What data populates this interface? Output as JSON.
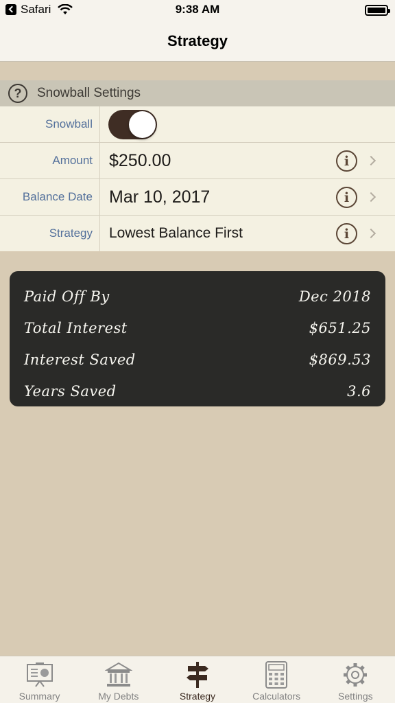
{
  "status_bar": {
    "back_app": "Safari",
    "time": "9:38 AM"
  },
  "nav": {
    "title": "Strategy"
  },
  "section": {
    "title": "Snowball Settings"
  },
  "settings": {
    "snowball": {
      "label": "Snowball",
      "enabled": true
    },
    "amount": {
      "label": "Amount",
      "value": "$250.00"
    },
    "balance_date": {
      "label": "Balance Date",
      "value": "Mar 10, 2017"
    },
    "strategy": {
      "label": "Strategy",
      "value": "Lowest Balance First"
    }
  },
  "summary": [
    {
      "label": "Paid Off By",
      "value": "Dec 2018"
    },
    {
      "label": "Total Interest",
      "value": "$651.25"
    },
    {
      "label": "Interest Saved",
      "value": "$869.53"
    },
    {
      "label": "Years Saved",
      "value": "3.6"
    }
  ],
  "tabs": [
    {
      "label": "Summary",
      "icon": "presentation-board-icon"
    },
    {
      "label": "My Debts",
      "icon": "bank-icon"
    },
    {
      "label": "Strategy",
      "icon": "signpost-icon",
      "active": true
    },
    {
      "label": "Calculators",
      "icon": "calculator-icon"
    },
    {
      "label": "Settings",
      "icon": "gear-icon"
    }
  ],
  "colors": {
    "background": "#d8cbb4",
    "toggle_on": "#3f2d24",
    "label_blue": "#53709b",
    "chalkboard": "#2a2a28",
    "active_tab": "#3b2a20"
  }
}
